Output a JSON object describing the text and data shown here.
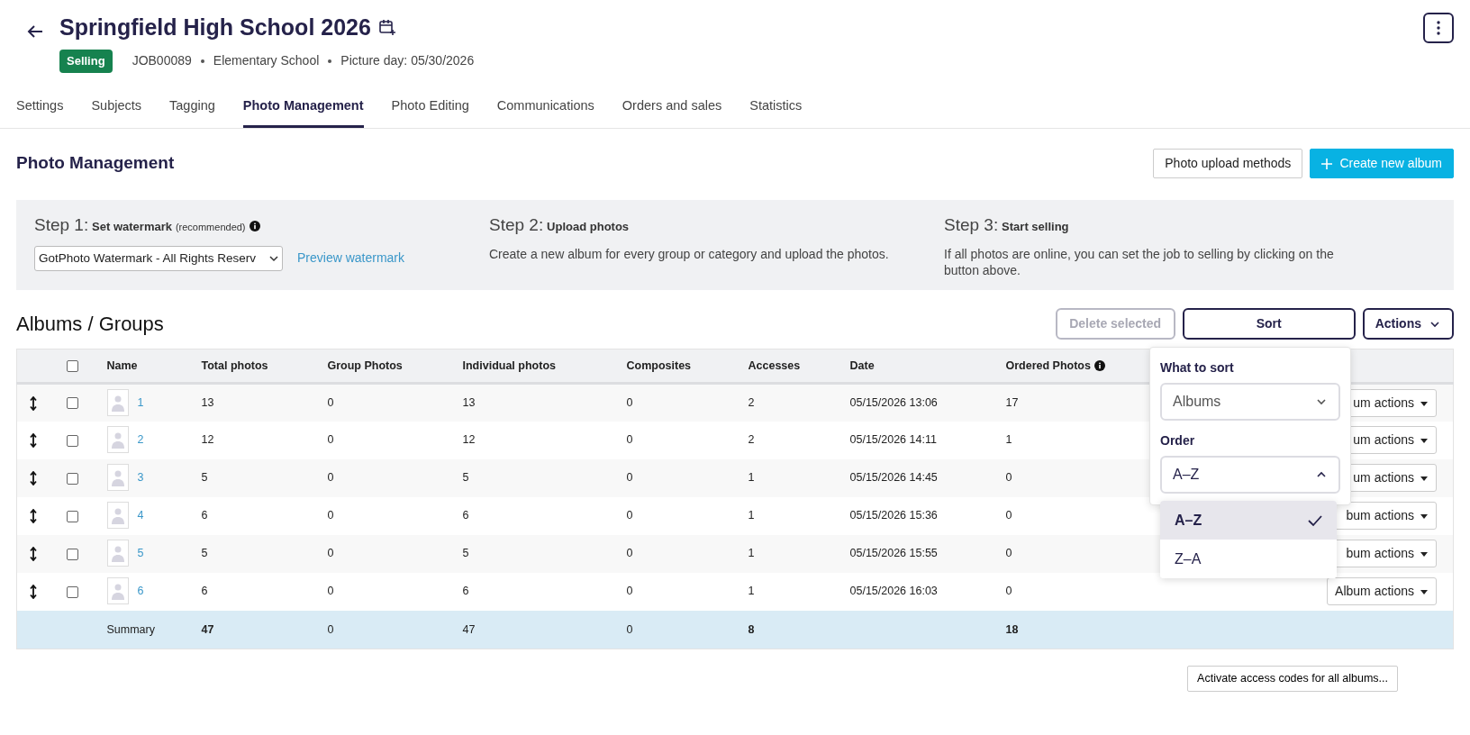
{
  "header": {
    "title": "Springfield High School 2026",
    "status": "Selling",
    "meta": [
      "JOB00089",
      "Elementary School",
      "Picture day: 05/30/2026"
    ]
  },
  "tabs": [
    {
      "label": "Settings",
      "selected": false
    },
    {
      "label": "Subjects",
      "selected": false
    },
    {
      "label": "Tagging",
      "selected": false
    },
    {
      "label": "Photo Management",
      "selected": true
    },
    {
      "label": "Photo Editing",
      "selected": false
    },
    {
      "label": "Communications",
      "selected": false
    },
    {
      "label": "Orders and sales",
      "selected": false
    },
    {
      "label": "Statistics",
      "selected": false
    }
  ],
  "section": {
    "title": "Photo Management",
    "buttons": [
      {
        "label": "Photo upload methods",
        "kind": "outline"
      },
      {
        "label": "Create new album",
        "kind": "primary"
      }
    ]
  },
  "steps": [
    {
      "number": "Step 1:",
      "title": "Set watermark",
      "note": "(recommended)",
      "select": "GotPhoto Watermark - All Rights Reserv",
      "link": "Preview watermark"
    },
    {
      "number": "Step 2:",
      "title": "Upload photos",
      "text": "Create a new album for every group or category and upload the photos."
    },
    {
      "number": "Step 3:",
      "title": "Start selling",
      "text": "If all photos are online, you can set the job to selling by clicking on the button above."
    }
  ],
  "albums": {
    "title": "Albums / Groups",
    "delete": {
      "label": "Delete selected",
      "disabled": true
    },
    "sort": "Sort",
    "actions": "Actions",
    "select_all": {
      "checked": false
    },
    "columns": [
      "Name",
      "Total photos",
      "Group Photos",
      "Individual photos",
      "Composites",
      "Accesses",
      "Date",
      "Ordered Photos"
    ],
    "rows": [
      {
        "checked": false,
        "name": "1",
        "total": "13",
        "group": "0",
        "individual": "13",
        "composites": "0",
        "accesses": "2",
        "date": "05/15/2026 13:06",
        "ordered": "17",
        "action": "um actions"
      },
      {
        "checked": false,
        "name": "2",
        "total": "12",
        "group": "0",
        "individual": "12",
        "composites": "0",
        "accesses": "2",
        "date": "05/15/2026 14:11",
        "ordered": "1",
        "action": "um actions"
      },
      {
        "checked": false,
        "name": "3",
        "total": "5",
        "group": "0",
        "individual": "5",
        "composites": "0",
        "accesses": "1",
        "date": "05/15/2026 14:45",
        "ordered": "0",
        "action": "um actions"
      },
      {
        "checked": false,
        "name": "4",
        "total": "6",
        "group": "0",
        "individual": "6",
        "composites": "0",
        "accesses": "1",
        "date": "05/15/2026 15:36",
        "ordered": "0",
        "action": "bum actions"
      },
      {
        "checked": false,
        "name": "5",
        "total": "5",
        "group": "0",
        "individual": "5",
        "composites": "0",
        "accesses": "1",
        "date": "05/15/2026 15:55",
        "ordered": "0",
        "action": "bum actions"
      },
      {
        "checked": false,
        "name": "6",
        "total": "6",
        "group": "0",
        "individual": "6",
        "composites": "0",
        "accesses": "1",
        "date": "05/15/2026 16:03",
        "ordered": "0",
        "action": "Album actions"
      }
    ],
    "summary": {
      "label": "Summary",
      "total": "47",
      "group": "0",
      "individual": "47",
      "composites": "0",
      "accesses": "8",
      "ordered": "18"
    }
  },
  "sort_popover": {
    "what_label": "What to sort",
    "what_value": "Albums",
    "order_label": "Order",
    "order_value": "A–Z",
    "order_expanded": true,
    "options": [
      {
        "label": "A–Z",
        "selected": true
      },
      {
        "label": "Z–A",
        "selected": false
      }
    ]
  },
  "footer_button": "Activate access codes for all albums..."
}
